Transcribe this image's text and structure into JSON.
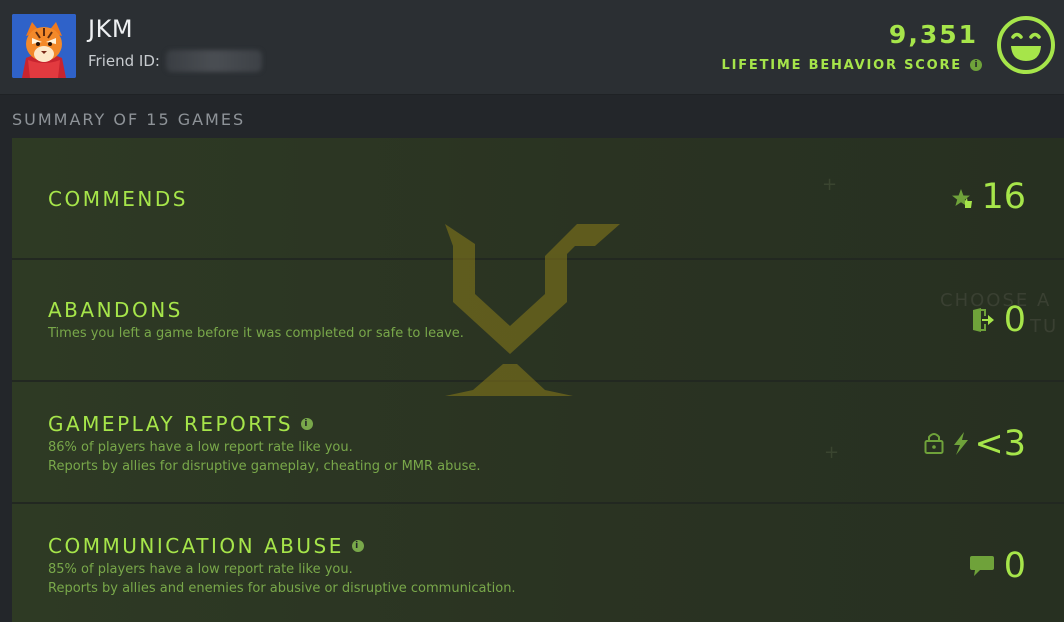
{
  "player": {
    "name": "JKM",
    "friend_id_label": "Friend ID:"
  },
  "behavior_score": {
    "value": "9,351",
    "label": "LIFETIME BEHAVIOR SCORE",
    "info_icon": "info-icon",
    "mood_icon": "smiley-face-icon"
  },
  "summary": {
    "title": "SUMMARY OF 15 GAMES",
    "rows": [
      {
        "title": "COMMENDS",
        "desc1": "",
        "desc2": "",
        "value": "16",
        "icon": "star-thumbs-up-icon"
      },
      {
        "title": "ABANDONS",
        "desc1": "Times you left a game before it was completed or safe to leave.",
        "desc2": "",
        "value": "0",
        "icon": "exit-door-icon"
      },
      {
        "title": "GAMEPLAY REPORTS",
        "desc1": "86% of players have a low report rate like you.",
        "desc2": "Reports by allies for disruptive gameplay, cheating or MMR abuse.",
        "value": "<3",
        "icon": "lock-lightning-icon"
      },
      {
        "title": "COMMUNICATION ABUSE",
        "desc1": "85% of players have a low report rate like you.",
        "desc2": "Reports by allies and enemies for abusive or disruptive communication.",
        "value": "0",
        "icon": "chat-bubble-icon"
      }
    ]
  },
  "colors": {
    "accent_green": "#a6e54a",
    "desc_green": "#79a84a",
    "background": "#23262a",
    "watermark_gold": "#9a8a1c"
  },
  "background_text": {
    "ghost1": "CHOOSE A",
    "ghost2": "TU"
  }
}
